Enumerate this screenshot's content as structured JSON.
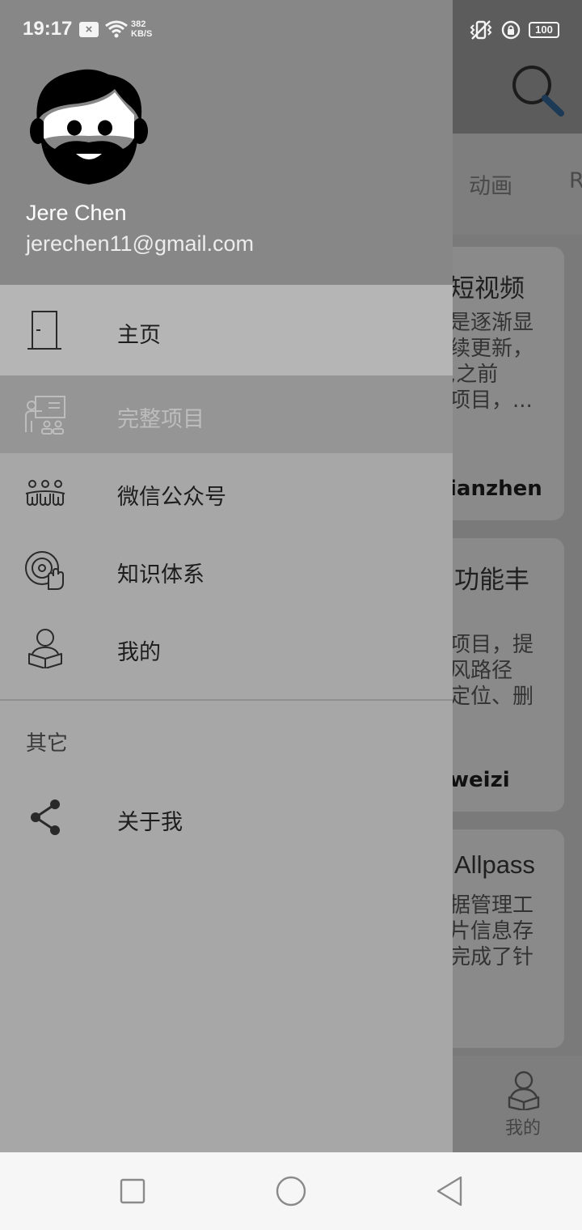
{
  "status_bar": {
    "time": "19:17",
    "notification_badge": "×",
    "net_speed_value": "382",
    "net_speed_unit": "KB/S",
    "battery": "100"
  },
  "background": {
    "tabs": [
      "动画",
      "R"
    ],
    "cards": [
      {
        "title": "短视频",
        "desc": [
          "是逐渐显",
          "续更新，",
          ",之前",
          "项目，..."
        ],
        "author": "ianzhen"
      },
      {
        "title": "功能丰",
        "desc": [
          "项目，提",
          "风路径",
          "定位、删"
        ],
        "author": "weizi"
      },
      {
        "title": "Allpass",
        "desc": [
          "据管理工",
          "片信息存",
          "完成了针"
        ],
        "author": ""
      }
    ],
    "bottom_nav_label": "我的"
  },
  "drawer": {
    "user": {
      "name": "Jere Chen",
      "email": "jerechen11@gmail.com"
    },
    "menu": [
      {
        "label": "主页",
        "icon": "door-icon"
      },
      {
        "label": "完整项目",
        "icon": "presentation-icon"
      },
      {
        "label": "微信公众号",
        "icon": "group-icon"
      },
      {
        "label": "知识体系",
        "icon": "disc-hand-icon"
      },
      {
        "label": "我的",
        "icon": "reader-icon"
      }
    ],
    "section_other": "其它",
    "about": {
      "label": "关于我",
      "icon": "share-icon"
    }
  },
  "colors": {
    "drawer_bg": "#a7a7a7",
    "header_bg": "#878787",
    "selected_bg": "#959595",
    "active_bg": "#b5b5b5",
    "text": "#1d1d1d"
  }
}
